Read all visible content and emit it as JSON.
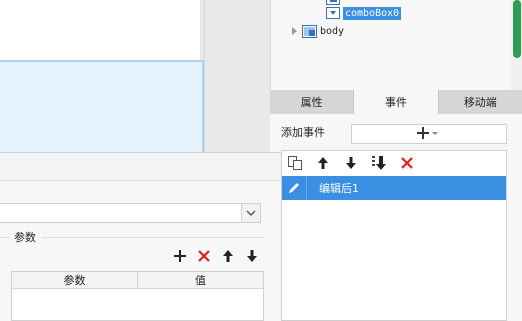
{
  "tree": {
    "items": [
      {
        "label": "comboBox0",
        "selected": true,
        "icon": "combobox-icon"
      },
      {
        "label": "body",
        "selected": false,
        "icon": "body-icon"
      }
    ]
  },
  "tabs": [
    {
      "label": "属性",
      "active": false
    },
    {
      "label": "事件",
      "active": true
    },
    {
      "label": "移动端",
      "active": false
    }
  ],
  "events": {
    "add_label": "添加事件",
    "add_button_icon": "plus-dropdown-icon",
    "toolbar_icons": [
      "copy-icon",
      "arrow-up-icon",
      "arrow-down-icon",
      "move-bottom-icon",
      "delete-icon"
    ],
    "items": [
      {
        "label": "编辑后1",
        "icon": "pencil-icon",
        "selected": true
      }
    ]
  },
  "params": {
    "section_title": "参数",
    "toolbar_icons": [
      "plus-icon",
      "delete-icon",
      "arrow-up-icon",
      "arrow-down-icon"
    ],
    "columns": [
      "参数",
      "值"
    ]
  },
  "colors": {
    "selection": "#3b8fe3",
    "canvas_selected": "#e3f2fc",
    "delete_red": "#e02020",
    "scroll_thumb": "#2e9e52"
  }
}
